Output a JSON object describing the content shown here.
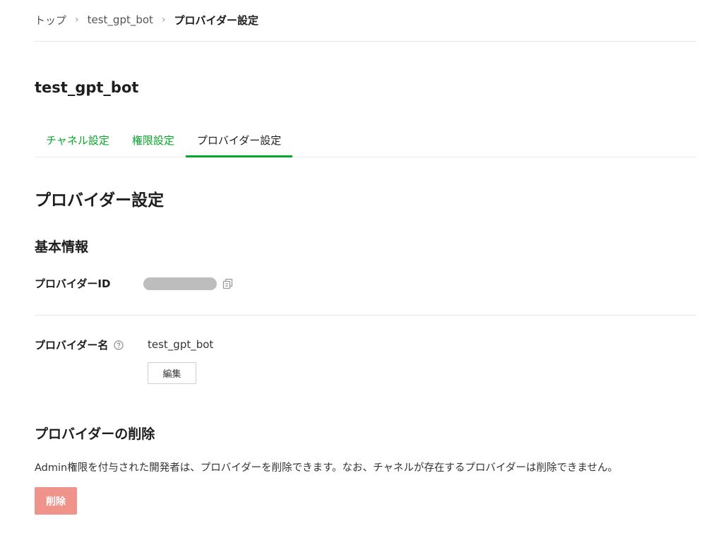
{
  "breadcrumb": {
    "items": [
      "トップ",
      "test_gpt_bot"
    ],
    "current": "プロバイダー設定",
    "separator": "›"
  },
  "bot": {
    "title": "test_gpt_bot"
  },
  "tabs": [
    {
      "label": "チャネル設定",
      "active": false
    },
    {
      "label": "権限設定",
      "active": false
    },
    {
      "label": "プロバイダー設定",
      "active": true
    }
  ],
  "page": {
    "heading": "プロバイダー設定"
  },
  "basic_info": {
    "heading": "基本情報",
    "provider_id_label": "プロバイダーID",
    "provider_name_label": "プロバイダー名",
    "provider_name_value": "test_gpt_bot",
    "edit_label": "編集"
  },
  "delete_section": {
    "heading": "プロバイダーの削除",
    "description": "Admin権限を付与された開発者は、プロバイダーを削除できます。なお、チャネルが存在するプロバイダーは削除できません。",
    "delete_label": "削除"
  },
  "icons": {
    "copy": "copy-icon",
    "help": "help-circle-icon",
    "chevron": "chevron-right-icon"
  },
  "colors": {
    "accent": "#06a829",
    "delete_button": "#f0938a",
    "masked_value": "#bdbdbd"
  }
}
